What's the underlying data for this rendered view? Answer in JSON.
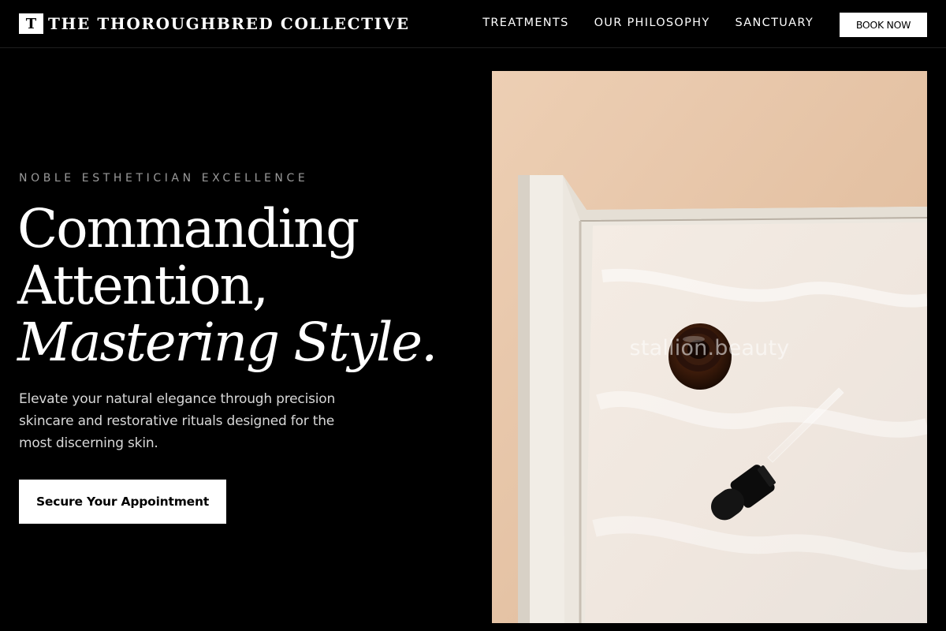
{
  "header": {
    "logo_letter": "T",
    "brand": "THE THOROUGHBRED COLLECTIVE",
    "nav": [
      {
        "label": "TREATMENTS"
      },
      {
        "label": "OUR PHILOSOPHY"
      },
      {
        "label": "SANCTUARY"
      }
    ],
    "book_label": "BOOK NOW"
  },
  "hero": {
    "eyebrow": "NOBLE ESTHETICIAN EXCELLENCE",
    "headline_line1": "Commanding",
    "headline_line2": "Attention,",
    "headline_line3": "Mastering Style.",
    "lede": "Elevate your natural elegance through precision skincare and restorative rituals designed for the most discerning skin.",
    "cta_label": "Secure Your Appointment",
    "image": {
      "watermark": "stallion.beauty",
      "subject": "amber serum bottle and dropper on white towel in tray"
    }
  },
  "colors": {
    "background": "#000000",
    "text": "#ffffff",
    "muted": "#9a9a9a",
    "button_bg": "#ffffff",
    "button_text": "#000000"
  }
}
